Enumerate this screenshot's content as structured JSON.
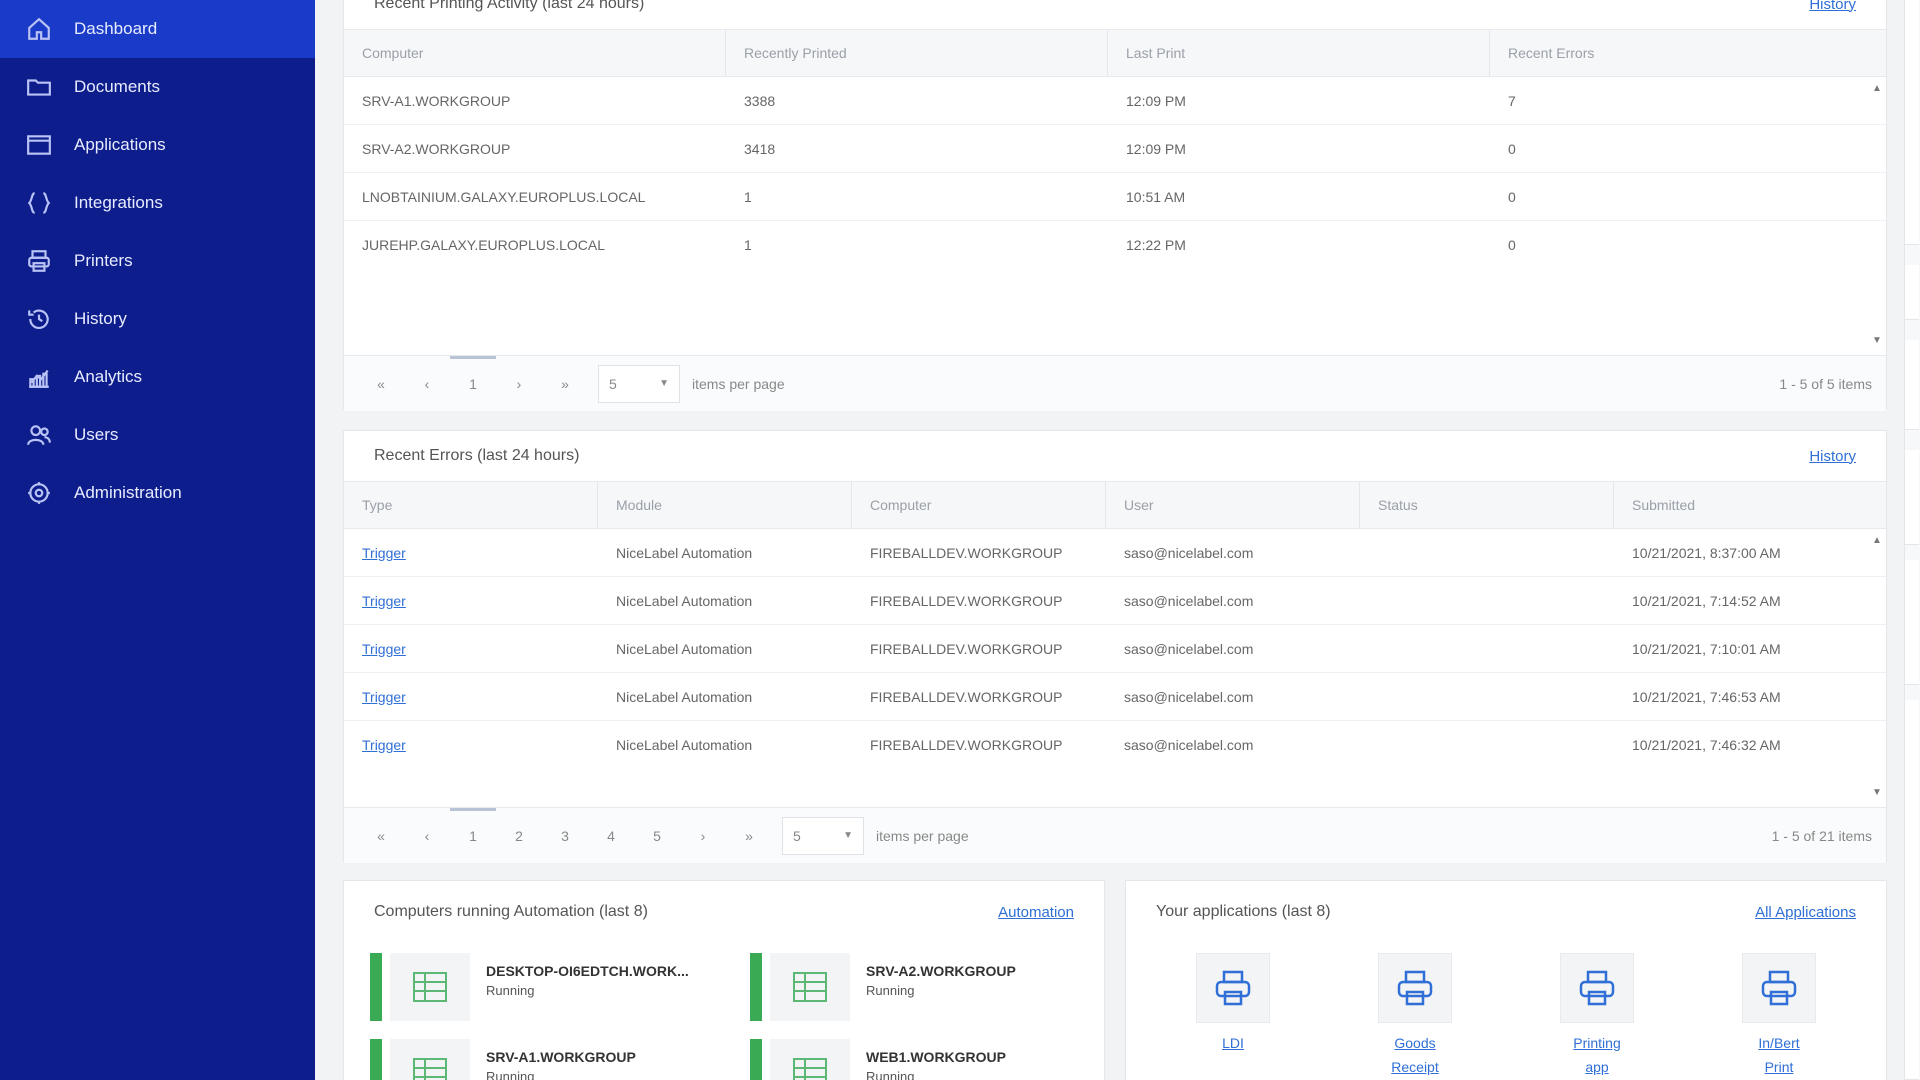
{
  "sidebar": {
    "items": [
      {
        "label": "Dashboard",
        "icon": "home-icon",
        "active": true
      },
      {
        "label": "Documents",
        "icon": "folder-icon"
      },
      {
        "label": "Applications",
        "icon": "window-icon"
      },
      {
        "label": "Integrations",
        "icon": "braces-icon"
      },
      {
        "label": "Printers",
        "icon": "printer-icon"
      },
      {
        "label": "History",
        "icon": "history-icon"
      },
      {
        "label": "Analytics",
        "icon": "analytics-icon"
      },
      {
        "label": "Users",
        "icon": "users-icon"
      },
      {
        "label": "Administration",
        "icon": "gear-icon"
      }
    ]
  },
  "printing": {
    "title": "Recent Printing Activity (last 24 hours)",
    "link": "History",
    "columns": [
      "Computer",
      "Recently Printed",
      "Last Print",
      "Recent Errors"
    ],
    "rows": [
      [
        "SRV-A1.WORKGROUP",
        "3388",
        "12:09 PM",
        "7"
      ],
      [
        "SRV-A2.WORKGROUP",
        "3418",
        "12:09 PM",
        "0"
      ],
      [
        "LNOBTAINIUM.GALAXY.EUROPLUS.LOCAL",
        "1",
        "10:51 AM",
        "0"
      ],
      [
        "JUREHP.GALAXY.EUROPLUS.LOCAL",
        "1",
        "12:22 PM",
        "0"
      ]
    ],
    "pager": {
      "first": "«",
      "prev": "‹",
      "pages": [
        "1"
      ],
      "next": "›",
      "last": "»",
      "per_page": "5",
      "per_page_label": "items per page",
      "summary": "1 - 5 of 5 items"
    }
  },
  "errors": {
    "title": "Recent Errors (last 24 hours)",
    "link": "History",
    "columns": [
      "Type",
      "Module",
      "Computer",
      "User",
      "Status",
      "Submitted"
    ],
    "rows": [
      [
        "Trigger",
        "NiceLabel Automation",
        "FIREBALLDEV.WORKGROUP",
        "saso@nicelabel.com",
        "",
        "10/21/2021, 8:37:00 AM"
      ],
      [
        "Trigger",
        "NiceLabel Automation",
        "FIREBALLDEV.WORKGROUP",
        "saso@nicelabel.com",
        "",
        "10/21/2021, 7:14:52 AM"
      ],
      [
        "Trigger",
        "NiceLabel Automation",
        "FIREBALLDEV.WORKGROUP",
        "saso@nicelabel.com",
        "",
        "10/21/2021, 7:10:01 AM"
      ],
      [
        "Trigger",
        "NiceLabel Automation",
        "FIREBALLDEV.WORKGROUP",
        "saso@nicelabel.com",
        "",
        "10/21/2021, 7:46:53 AM"
      ],
      [
        "Trigger",
        "NiceLabel Automation",
        "FIREBALLDEV.WORKGROUP",
        "saso@nicelabel.com",
        "",
        "10/21/2021, 7:46:32 AM"
      ]
    ],
    "pager": {
      "first": "«",
      "prev": "‹",
      "pages": [
        "1",
        "2",
        "3",
        "4",
        "5"
      ],
      "next": "›",
      "last": "»",
      "per_page": "5",
      "per_page_label": "items per page",
      "summary": "1 - 5 of 21 items"
    }
  },
  "computers": {
    "title": "Computers running Automation (last 8)",
    "link": "Automation",
    "items": [
      {
        "name": "DESKTOP-OI6EDTCH.WORK...",
        "status": "Running"
      },
      {
        "name": "SRV-A2.WORKGROUP",
        "status": "Running"
      },
      {
        "name": "SRV-A1.WORKGROUP",
        "status": "Running"
      },
      {
        "name": "WEB1.WORKGROUP",
        "status": "Running"
      }
    ]
  },
  "apps": {
    "title": "Your applications (last 8)",
    "link": "All Applications",
    "items": [
      {
        "line1": "LDI",
        "line2": ""
      },
      {
        "line1": "Goods",
        "line2": "Receipt"
      },
      {
        "line1": "Printing",
        "line2": "app"
      },
      {
        "line1": "In/Bert",
        "line2": "Print"
      }
    ]
  },
  "colors": {
    "sidebar": "#0d1d8c",
    "sidebar_active": "#1a3bc7",
    "link": "#2f6fd6",
    "running": "#3aaa55"
  }
}
